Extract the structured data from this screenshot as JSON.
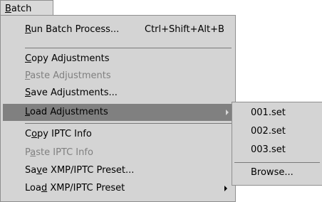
{
  "menubar": {
    "batch": {
      "pre": "",
      "u": "B",
      "post": "atch"
    }
  },
  "menu": [
    {
      "pre": "",
      "u": "R",
      "post": "un Batch Process...",
      "shortcut": "Ctrl+Shift+Alt+B",
      "state": "enabled"
    },
    {
      "pre": "",
      "u": "C",
      "post": "opy Adjustments",
      "state": "enabled"
    },
    {
      "pre": "",
      "u": "P",
      "post": "aste Adjustments",
      "state": "disabled"
    },
    {
      "pre": "",
      "u": "S",
      "post": "ave Adjustments...",
      "state": "enabled"
    },
    {
      "pre": "",
      "u": "L",
      "post": "oad Adjustments",
      "state": "highlighted",
      "submenu": true
    },
    {
      "pre": "C",
      "u": "o",
      "post": "py IPTC Info",
      "state": "enabled"
    },
    {
      "pre": "P",
      "u": "a",
      "post": "ste IPTC Info",
      "state": "disabled"
    },
    {
      "pre": "Sa",
      "u": "v",
      "post": "e XMP/IPTC Preset...",
      "state": "enabled"
    },
    {
      "pre": "Loa",
      "u": "d",
      "post": " XMP/IPTC Preset",
      "state": "enabled",
      "submenu": true
    }
  ],
  "submenu": {
    "items": [
      "001.set",
      "002.set",
      "003.set"
    ],
    "browse": "Browse..."
  },
  "colors": {
    "menu_bg": "#d4d4d4",
    "highlight_bg": "#808080",
    "disabled_text": "#808080"
  }
}
